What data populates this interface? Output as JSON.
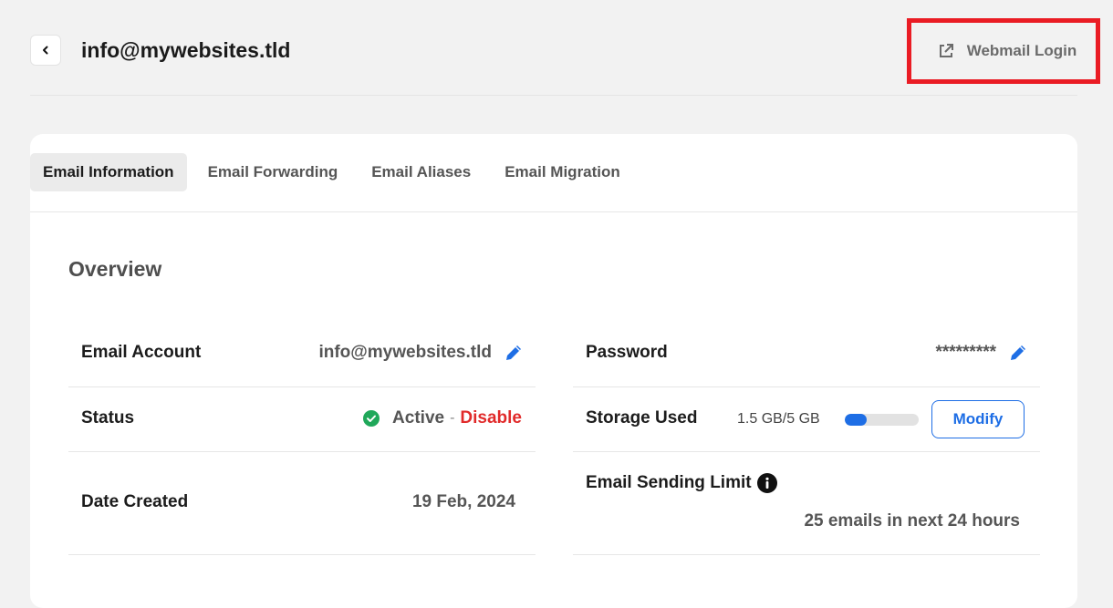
{
  "header": {
    "title": "info@mywebsites.tld",
    "webmail_label": "Webmail Login"
  },
  "tabs": [
    {
      "label": "Email Information",
      "active": true
    },
    {
      "label": "Email Forwarding",
      "active": false
    },
    {
      "label": "Email Aliases",
      "active": false
    },
    {
      "label": "Email Migration",
      "active": false
    }
  ],
  "overview": {
    "title": "Overview",
    "email_account": {
      "label": "Email Account",
      "value": "info@mywebsites.tld"
    },
    "password": {
      "label": "Password",
      "value": "*********"
    },
    "status": {
      "label": "Status",
      "value": "Active",
      "separator": "-",
      "action": "Disable"
    },
    "storage": {
      "label": "Storage Used",
      "value": "1.5 GB/5 GB",
      "fraction": 0.3,
      "action": "Modify"
    },
    "date_created": {
      "label": "Date Created",
      "value": "19 Feb, 2024"
    },
    "sending_limit": {
      "label": "Email Sending Limit",
      "value": "25 emails in next 24 hours"
    }
  },
  "colors": {
    "accent": "#1e6ee5",
    "danger": "#e12a2a",
    "success": "#20a85a",
    "highlight_box": "#ea1c24"
  },
  "icons": {
    "back": "chevron-left-icon",
    "webmail": "external-link-icon",
    "edit": "pencil-icon",
    "status": "check-circle-icon",
    "info": "info-icon"
  }
}
